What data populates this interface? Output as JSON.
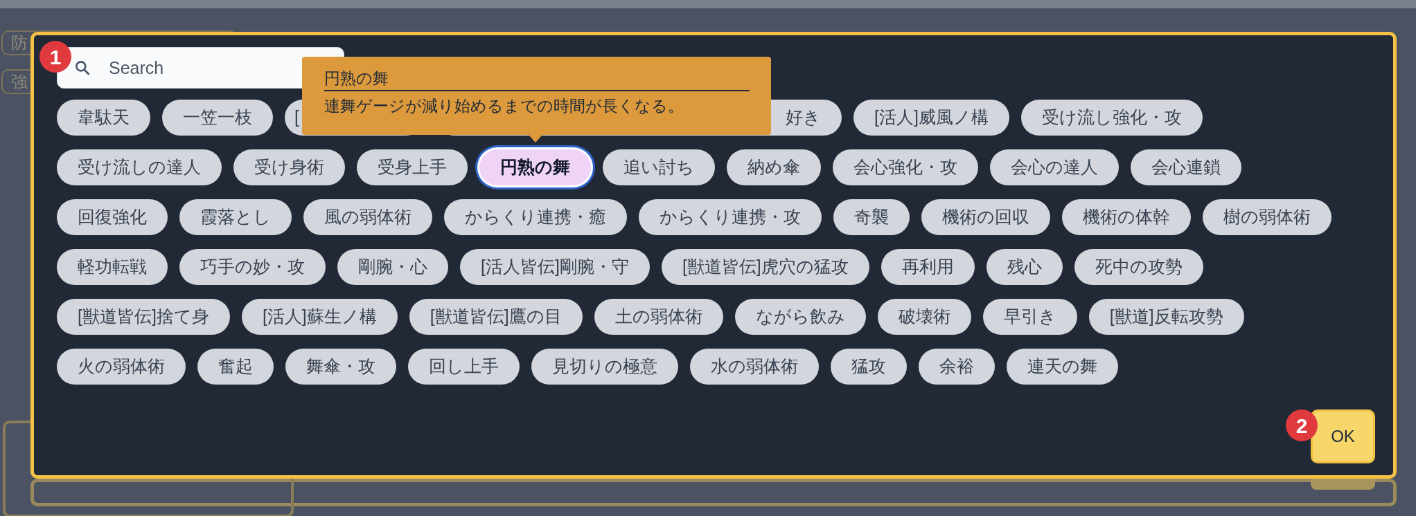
{
  "background": {
    "chips": [
      "防",
      "強"
    ]
  },
  "dialog": {
    "badge": "1",
    "search": {
      "placeholder": "Search"
    },
    "chip_rows": [
      [
        {
          "label": "韋駄天",
          "selected": false
        },
        {
          "label": "一笠一枝",
          "selected": false
        },
        {
          "label": "[",
          "selected": false,
          "kind": "cut_right"
        },
        {
          "label": "好き",
          "selected": false,
          "kind": "cut_left"
        },
        {
          "label": "[活人]威風ノ構",
          "selected": false
        },
        {
          "label": "受け流し強化・攻",
          "selected": false
        }
      ],
      [
        {
          "label": "受け流しの達人",
          "selected": false
        },
        {
          "label": "受け身術",
          "selected": false
        },
        {
          "label": "受身上手",
          "selected": false
        },
        {
          "label": "円熟の舞",
          "selected": true
        },
        {
          "label": "追い討ち",
          "selected": false
        },
        {
          "label": "納め傘",
          "selected": false
        },
        {
          "label": "会心強化・攻",
          "selected": false
        },
        {
          "label": "会心の達人",
          "selected": false
        },
        {
          "label": "会心連鎖",
          "selected": false
        }
      ],
      [
        {
          "label": "回復強化",
          "selected": false
        },
        {
          "label": "霞落とし",
          "selected": false
        },
        {
          "label": "風の弱体術",
          "selected": false
        },
        {
          "label": "からくり連携・癒",
          "selected": false
        },
        {
          "label": "からくり連携・攻",
          "selected": false
        },
        {
          "label": "奇襲",
          "selected": false
        },
        {
          "label": "機術の回収",
          "selected": false
        },
        {
          "label": "機術の体幹",
          "selected": false
        },
        {
          "label": "樹の弱体術",
          "selected": false
        }
      ],
      [
        {
          "label": "軽功転戦",
          "selected": false
        },
        {
          "label": "巧手の妙・攻",
          "selected": false
        },
        {
          "label": "剛腕・心",
          "selected": false
        },
        {
          "label": "[活人皆伝]剛腕・守",
          "selected": false
        },
        {
          "label": "[獣道皆伝]虎穴の猛攻",
          "selected": false
        },
        {
          "label": "再利用",
          "selected": false
        },
        {
          "label": "残心",
          "selected": false
        },
        {
          "label": "死中の攻勢",
          "selected": false
        }
      ],
      [
        {
          "label": "[獣道皆伝]捨て身",
          "selected": false
        },
        {
          "label": "[活人]蘇生ノ構",
          "selected": false
        },
        {
          "label": "[獣道皆伝]鷹の目",
          "selected": false
        },
        {
          "label": "土の弱体術",
          "selected": false
        },
        {
          "label": "ながら飲み",
          "selected": false
        },
        {
          "label": "破壊術",
          "selected": false
        },
        {
          "label": "早引き",
          "selected": false
        },
        {
          "label": "[獣道]反転攻勢",
          "selected": false
        }
      ],
      [
        {
          "label": "火の弱体術",
          "selected": false
        },
        {
          "label": "奮起",
          "selected": false
        },
        {
          "label": "舞傘・攻",
          "selected": false
        },
        {
          "label": "回し上手",
          "selected": false
        },
        {
          "label": "見切りの極意",
          "selected": false
        },
        {
          "label": "水の弱体術",
          "selected": false
        },
        {
          "label": "猛攻",
          "selected": false
        },
        {
          "label": "余裕",
          "selected": false
        },
        {
          "label": "連天の舞",
          "selected": false
        }
      ]
    ],
    "tooltip": {
      "title": "円熟の舞",
      "description": "連舞ゲージが減り始めるまでの時間が長くなる。"
    },
    "ok_badge": "2",
    "ok_button": "OK"
  }
}
